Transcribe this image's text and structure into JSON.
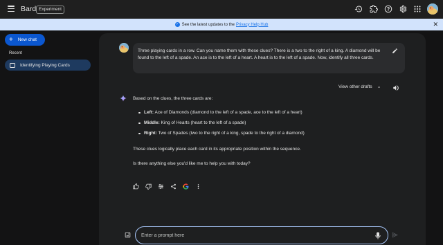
{
  "header": {
    "brand": "Bard",
    "badge": "Experiment",
    "icons": [
      "history-icon",
      "extensions-icon",
      "help-icon",
      "settings-icon",
      "apps-icon"
    ]
  },
  "banner": {
    "text": "See the latest updates to the",
    "link": "Privacy Help Hub"
  },
  "sidebar": {
    "new_chat_label": "New chat",
    "recent_label": "Recent",
    "items": [
      {
        "label": "Identifying Playing Cards",
        "active": true
      }
    ]
  },
  "conversation": {
    "prompt": "Three playing cards in a row. Can you name them with these clues? There is a two to the right of a king. A diamond will be found to the left of a spade. An ace is to the left of a heart. A heart is to the left of a spade. Now, identify all three cards.",
    "view_drafts_label": "View other drafts",
    "response": {
      "intro": "Based on the clues, the three cards are:",
      "bullets": [
        {
          "label": "Left:",
          "text": " Ace of Diamonds (diamond to the left of a spade, ace to the left of a heart)"
        },
        {
          "label": "Middle:",
          "text": " King of Hearts (heart to the left of a spade)"
        },
        {
          "label": "Right:",
          "text": " Two of Spades (two to the right of a king, spade to the right of a diamond)"
        }
      ],
      "paragraph2": "These clues logically place each card in its appropriate position within the sequence.",
      "paragraph3": "Is there anything else you'd like me to help you with today?"
    }
  },
  "input": {
    "placeholder": "Enter a prompt here",
    "value": ""
  },
  "colors": {
    "background": "#131314",
    "panel": "#1e1f20",
    "accent": "#0b57d0",
    "banner": "#d2e3fc",
    "active_item": "#1e3a5f"
  }
}
